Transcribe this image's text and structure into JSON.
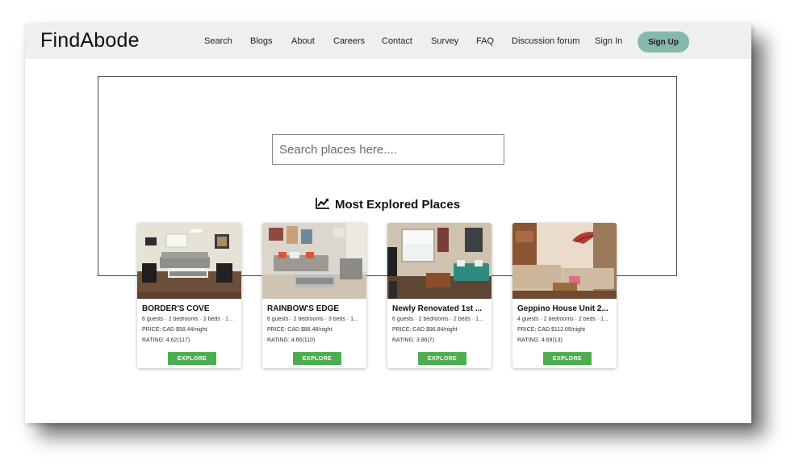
{
  "header": {
    "brand": "FindAbode",
    "nav": [
      "Search",
      "Blogs",
      "About",
      "Careers",
      "Contact",
      "Survey",
      "FAQ",
      "Discussion forum",
      "Sign In"
    ],
    "signup_label": "Sign Up"
  },
  "search": {
    "placeholder": "Search places here...."
  },
  "section": {
    "title": "Most Explored Places"
  },
  "cards": [
    {
      "title": "BORDER'S COVE",
      "meta": "6 guests · 2 bedrooms · 2 beds · 1...",
      "price": "PRICE: CAD $58.44/night",
      "rating": "RATING: 4.62(117)",
      "button": "EXPLORE"
    },
    {
      "title": "RAINBOW'S EDGE",
      "meta": "6 guests · 2 bedrooms · 3 beds · 1...",
      "price": "PRICE: CAD $88.48/night",
      "rating": "RATING: 4.66(110)",
      "button": "EXPLORE"
    },
    {
      "title": "Newly Renovated 1st ...",
      "meta": "6 guests · 2 bedrooms · 2 beds · 1...",
      "price": "PRICE: CAD $96.84/night",
      "rating": "RATING: 3.86(7)",
      "button": "EXPLORE"
    },
    {
      "title": "Geppino House Unit 2...",
      "meta": "4 guests · 2 bedrooms · 2 beds · 1...",
      "price": "PRICE: CAD $112.09/night",
      "rating": "RATING: 4.69(13)",
      "button": "EXPLORE"
    }
  ],
  "colors": {
    "navbar": "#efefef",
    "signup": "#86b9ad",
    "explore": "#4cae4f"
  },
  "icons": {
    "section": "trending-up-icon"
  }
}
